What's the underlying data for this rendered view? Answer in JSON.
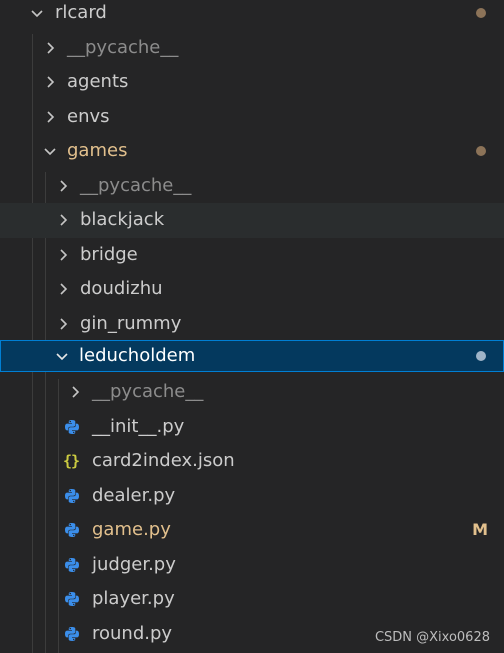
{
  "colors": {
    "background": "#252526",
    "selected_background": "#04395e",
    "selected_border": "#007fd4",
    "modified": "#e2c08d",
    "python_icon": "#3b8eea",
    "json_icon": "#cbcb41"
  },
  "tree": {
    "root": {
      "label": "rlcard",
      "state": "expanded",
      "has_changes": true
    },
    "items": [
      {
        "label": "__pycache__",
        "type": "folder",
        "state": "collapsed"
      },
      {
        "label": "agents",
        "type": "folder",
        "state": "collapsed"
      },
      {
        "label": "envs",
        "type": "folder",
        "state": "collapsed"
      },
      {
        "label": "games",
        "type": "folder",
        "state": "expanded",
        "has_changes": true
      },
      {
        "label": "__pycache__",
        "type": "folder",
        "state": "collapsed"
      },
      {
        "label": "blackjack",
        "type": "folder",
        "state": "collapsed"
      },
      {
        "label": "bridge",
        "type": "folder",
        "state": "collapsed"
      },
      {
        "label": "doudizhu",
        "type": "folder",
        "state": "collapsed"
      },
      {
        "label": "gin_rummy",
        "type": "folder",
        "state": "collapsed"
      },
      {
        "label": "leducholdem",
        "type": "folder",
        "state": "expanded",
        "selected": true,
        "has_changes": true
      },
      {
        "label": "__pycache__",
        "type": "folder",
        "state": "collapsed"
      },
      {
        "label": "__init__.py",
        "type": "file",
        "icon": "python-icon"
      },
      {
        "label": "card2index.json",
        "type": "file",
        "icon": "json-icon",
        "icon_text": "{}"
      },
      {
        "label": "dealer.py",
        "type": "file",
        "icon": "python-icon"
      },
      {
        "label": "game.py",
        "type": "file",
        "icon": "python-icon",
        "git_status": "M"
      },
      {
        "label": "judger.py",
        "type": "file",
        "icon": "python-icon"
      },
      {
        "label": "player.py",
        "type": "file",
        "icon": "python-icon"
      },
      {
        "label": "round.py",
        "type": "file",
        "icon": "python-icon"
      }
    ]
  },
  "watermark": "CSDN @Xixo0628"
}
